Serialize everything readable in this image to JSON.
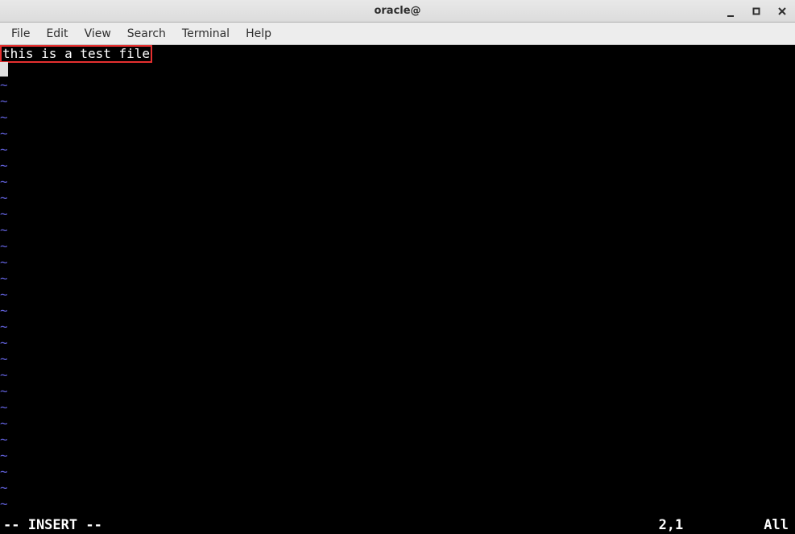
{
  "window": {
    "title": "oracle@"
  },
  "menu": {
    "file": "File",
    "edit": "Edit",
    "view": "View",
    "search": "Search",
    "terminal": "Terminal",
    "help": "Help"
  },
  "editor": {
    "line1": "this is a test file",
    "tilde": "~",
    "tilde_count": 27
  },
  "status": {
    "mode": "-- INSERT --",
    "position": "2,1",
    "percent": "All"
  }
}
